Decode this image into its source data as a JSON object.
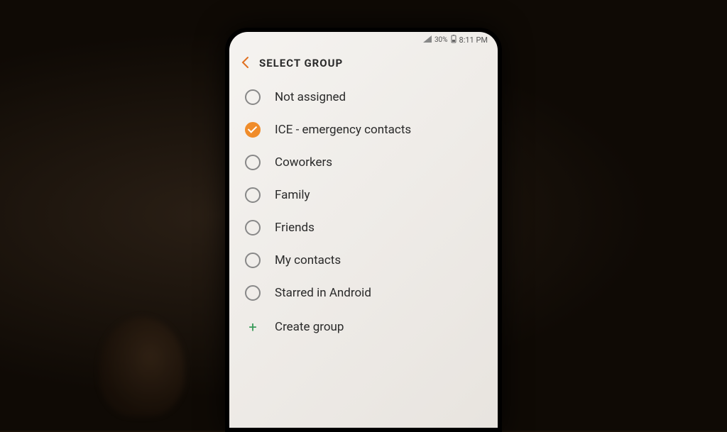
{
  "status_bar": {
    "battery": "30%",
    "time": "8:11 PM"
  },
  "header": {
    "title": "SELECT GROUP"
  },
  "groups": [
    {
      "label": "Not assigned",
      "checked": false
    },
    {
      "label": "ICE - emergency contacts",
      "checked": true
    },
    {
      "label": "Coworkers",
      "checked": false
    },
    {
      "label": "Family",
      "checked": false
    },
    {
      "label": "Friends",
      "checked": false
    },
    {
      "label": "My contacts",
      "checked": false
    },
    {
      "label": "Starred in Android",
      "checked": false
    }
  ],
  "create": {
    "label": "Create group"
  }
}
